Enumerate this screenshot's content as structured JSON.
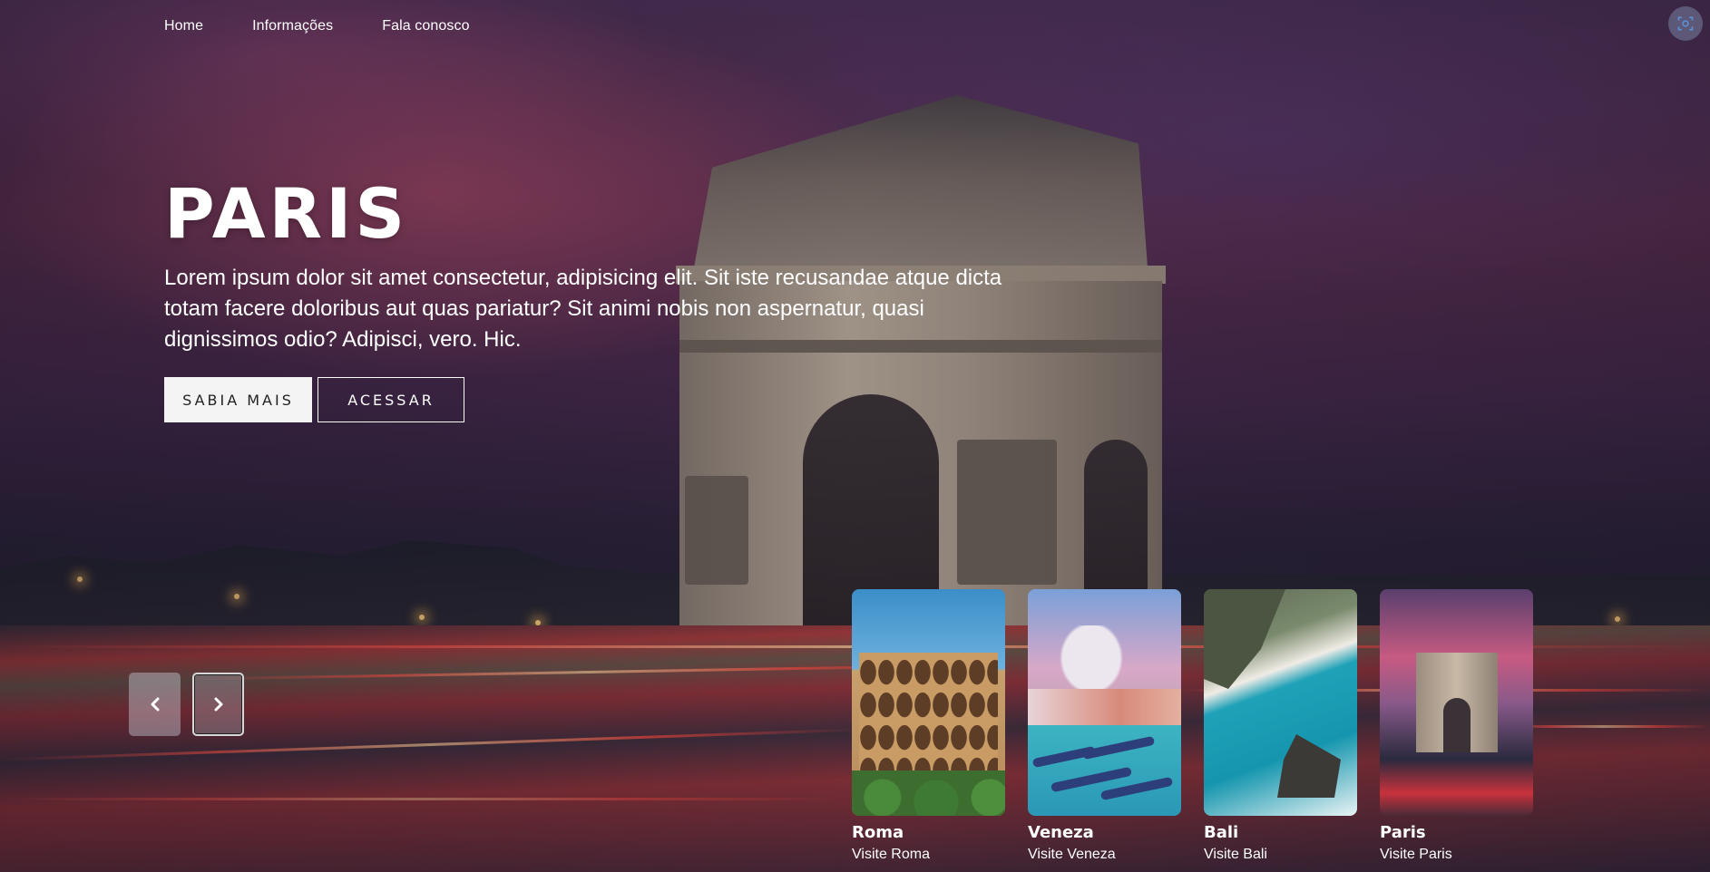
{
  "nav": {
    "items": [
      {
        "label": "Home"
      },
      {
        "label": "Informações"
      },
      {
        "label": "Fala conosco"
      }
    ]
  },
  "hero": {
    "title": "PARIS",
    "description": "Lorem ipsum dolor sit amet consectetur, adipisicing elit. Sit iste recusandae atque dicta totam facere doloribus aut quas pariatur? Sit animi nobis non aspernatur, quasi dignissimos odio? Adipisci, vero. Hic.",
    "primary_button": "SABIA MAIS",
    "secondary_button": "ACESSAR"
  },
  "slider": {
    "prev_icon": "chevron-left-icon",
    "next_icon": "chevron-right-icon"
  },
  "cards": [
    {
      "name": "Roma",
      "subtitle": "Visite Roma"
    },
    {
      "name": "Veneza",
      "subtitle": "Visite Veneza"
    },
    {
      "name": "Bali",
      "subtitle": "Visite Bali"
    },
    {
      "name": "Paris",
      "subtitle": "Visite Paris"
    }
  ],
  "colors": {
    "button_light_bg": "#f4f4f4",
    "button_light_text": "#222222",
    "text": "#ffffff"
  }
}
